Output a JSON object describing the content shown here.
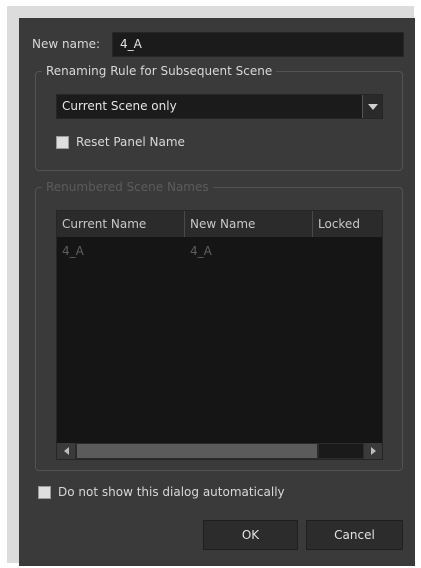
{
  "dialog": {
    "name_label": "New name:",
    "name_value": "4_A",
    "renaming_group": {
      "title": "Renaming Rule for Subsequent Scene",
      "rule_selected": "Current Scene only",
      "reset_panel_label": "Reset Panel Name",
      "reset_panel_checked": false
    },
    "renumbered_group": {
      "title": "Renumbered Scene Names",
      "columns": [
        "Current Name",
        "New Name",
        "Locked"
      ],
      "rows": [
        {
          "current": "4_A",
          "new": "4_A",
          "locked": ""
        }
      ]
    },
    "dont_show_label": "Do not show this dialog automatically",
    "dont_show_checked": false,
    "ok_label": "OK",
    "cancel_label": "Cancel"
  },
  "colors": {
    "dialog_bg": "#3a3a3a",
    "field_bg": "#1b1b1b",
    "table_bg": "#151515",
    "disabled_text": "#5c5c5c"
  },
  "icons": [
    "dropdown-arrow-icon",
    "scroll-left-icon",
    "scroll-right-icon"
  ]
}
